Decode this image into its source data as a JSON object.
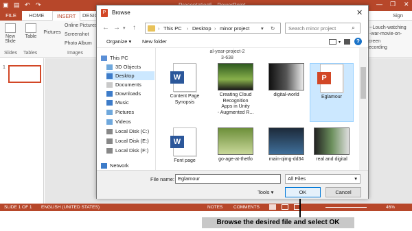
{
  "ppt": {
    "title": "Presentation5 - PowerPoint",
    "signin": "Sign in",
    "tabs": [
      "FILE",
      "HOME",
      "INSERT",
      "DESIGN"
    ],
    "ribbon": {
      "new_slide": "New\nSlide",
      "table": "Table",
      "pictures": "Pictures",
      "online_pictures": "Online Pictures",
      "screenshot": "Screenshot",
      "photo_album": "Photo Album",
      "right_text": "--Louch-watching\n-war-movie-on-",
      "screen_recording": "Screen\nRecording",
      "groups": {
        "slides": "Slides",
        "tables": "Tables",
        "images": "Images"
      }
    },
    "slide_number": "1",
    "status": {
      "slide": "SLIDE 1 OF 1",
      "language": "ENGLISH (UNITED STATES)",
      "notes": "NOTES",
      "comments": "COMMENTS",
      "zoom": "46%"
    }
  },
  "dialog": {
    "title": "Browse",
    "breadcrumb": [
      "This PC",
      "Desktop",
      "minor project"
    ],
    "search_placeholder": "Search minor project",
    "organize": "Organize ▾",
    "new_folder": "New folder",
    "nav": [
      {
        "label": "This PC",
        "icon": "pc-icon",
        "color": "#5b8fd6"
      },
      {
        "label": "3D Objects",
        "icon": "cube-icon",
        "color": "#6fa8dc"
      },
      {
        "label": "Desktop",
        "icon": "desktop-icon",
        "color": "#3d7cc9"
      },
      {
        "label": "Documents",
        "icon": "documents-icon",
        "color": "#c9c9c9"
      },
      {
        "label": "Downloads",
        "icon": "download-icon",
        "color": "#3d7cc9"
      },
      {
        "label": "Music",
        "icon": "music-icon",
        "color": "#3d7cc9"
      },
      {
        "label": "Pictures",
        "icon": "pictures-icon",
        "color": "#6fa8dc"
      },
      {
        "label": "Videos",
        "icon": "videos-icon",
        "color": "#6fa8dc"
      },
      {
        "label": "Local Disk (C:)",
        "icon": "disk-icon",
        "color": "#888"
      },
      {
        "label": "Local Disk (E:)",
        "icon": "disk-icon",
        "color": "#888"
      },
      {
        "label": "Local Disk (F:)",
        "icon": "disk-icon",
        "color": "#888"
      },
      {
        "label": "Network",
        "icon": "network-icon",
        "color": "#3d7cc9"
      }
    ],
    "top_partial": "al-year-project-2\n3-638",
    "files": [
      {
        "label": "Content Page\nSynopsis",
        "kind": "word"
      },
      {
        "label": "Creating Cloud\nRecognition\nApps in Unity\n- Augmented R...",
        "kind": "film"
      },
      {
        "label": "digital-world",
        "kind": "photo1"
      },
      {
        "label": "Eglamour",
        "kind": "ppt"
      },
      {
        "label": "Font page",
        "kind": "word"
      },
      {
        "label": "go-age-at-thetfo",
        "kind": "photo2"
      },
      {
        "label": "main-qimg-dd34",
        "kind": "photo3"
      },
      {
        "label": "real and digital",
        "kind": "photo4"
      }
    ],
    "filename_label": "File name:",
    "filename_value": "Eglamour",
    "filter": "All Files",
    "tools": "Tools",
    "ok": "OK",
    "cancel": "Cancel"
  },
  "caption": "Browse the desired file and select OK"
}
